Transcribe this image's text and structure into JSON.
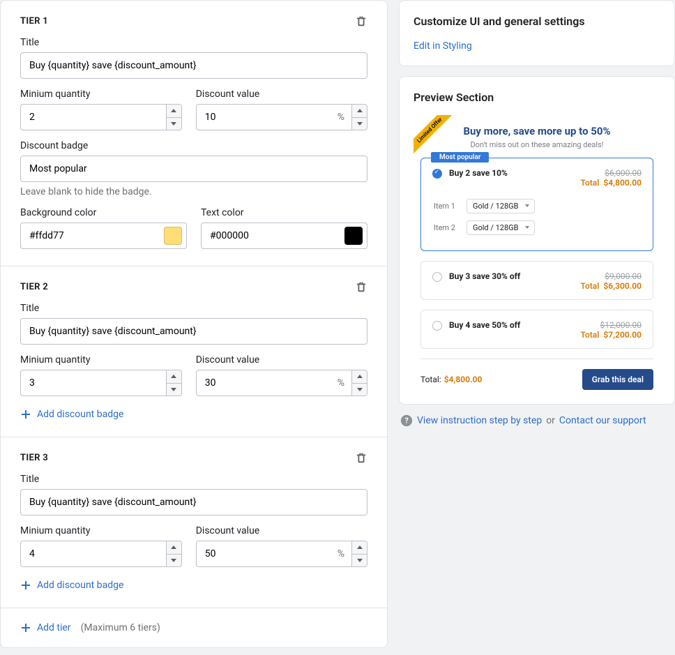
{
  "labels": {
    "title": "Title",
    "min_qty": "Minium quantity",
    "discount_value": "Discount value",
    "discount_badge": "Discount badge",
    "badge_hint": "Leave blank to hide the badge.",
    "bg_color": "Background color",
    "text_color": "Text color",
    "add_badge": "Add discount badge",
    "add_tier": "Add tier",
    "max_tiers": "(Maximum 6 tiers)",
    "percent": "%"
  },
  "tiers": [
    {
      "name": "TIER 1",
      "title_value": "Buy {quantity} save {discount_amount}",
      "min_qty": "2",
      "discount_value": "10",
      "has_badge": true,
      "badge_text": "Most popular",
      "bg_color": "#ffdd77",
      "text_color": "#000000"
    },
    {
      "name": "TIER 2",
      "title_value": "Buy {quantity} save {discount_amount}",
      "min_qty": "3",
      "discount_value": "30",
      "has_badge": false
    },
    {
      "name": "TIER 3",
      "title_value": "Buy {quantity} save {discount_amount}",
      "min_qty": "4",
      "discount_value": "50",
      "has_badge": false
    }
  ],
  "customize": {
    "heading": "Customize UI and general settings",
    "link": "Edit in Styling"
  },
  "preview": {
    "heading": "Preview Section",
    "ribbon": "Limited Offer",
    "title": "Buy more, save more up to 50%",
    "subtitle": "Don't miss out on these amazing deals!",
    "badge": "Most popular",
    "options": [
      {
        "label": "Buy 2 save 10%",
        "strike": "$6,000.00",
        "total": "$4,800.00",
        "selected": true
      },
      {
        "label": "Buy 3 save 30% off",
        "strike": "$9,000.00",
        "total": "$6,300.00",
        "selected": false
      },
      {
        "label": "Buy 4 save 50% off",
        "strike": "$12,000.00",
        "total": "$7,200.00",
        "selected": false
      }
    ],
    "total_label": "Total",
    "items": [
      {
        "name": "Item 1",
        "variant": "Gold / 128GB"
      },
      {
        "name": "Item 2",
        "variant": "Gold / 128GB"
      }
    ],
    "footer_total_label": "Total:",
    "footer_total": "$4,800.00",
    "cta": "Grab this deal"
  },
  "help": {
    "instruction": "View instruction step by step",
    "or": "or",
    "support": "Contact our support"
  }
}
